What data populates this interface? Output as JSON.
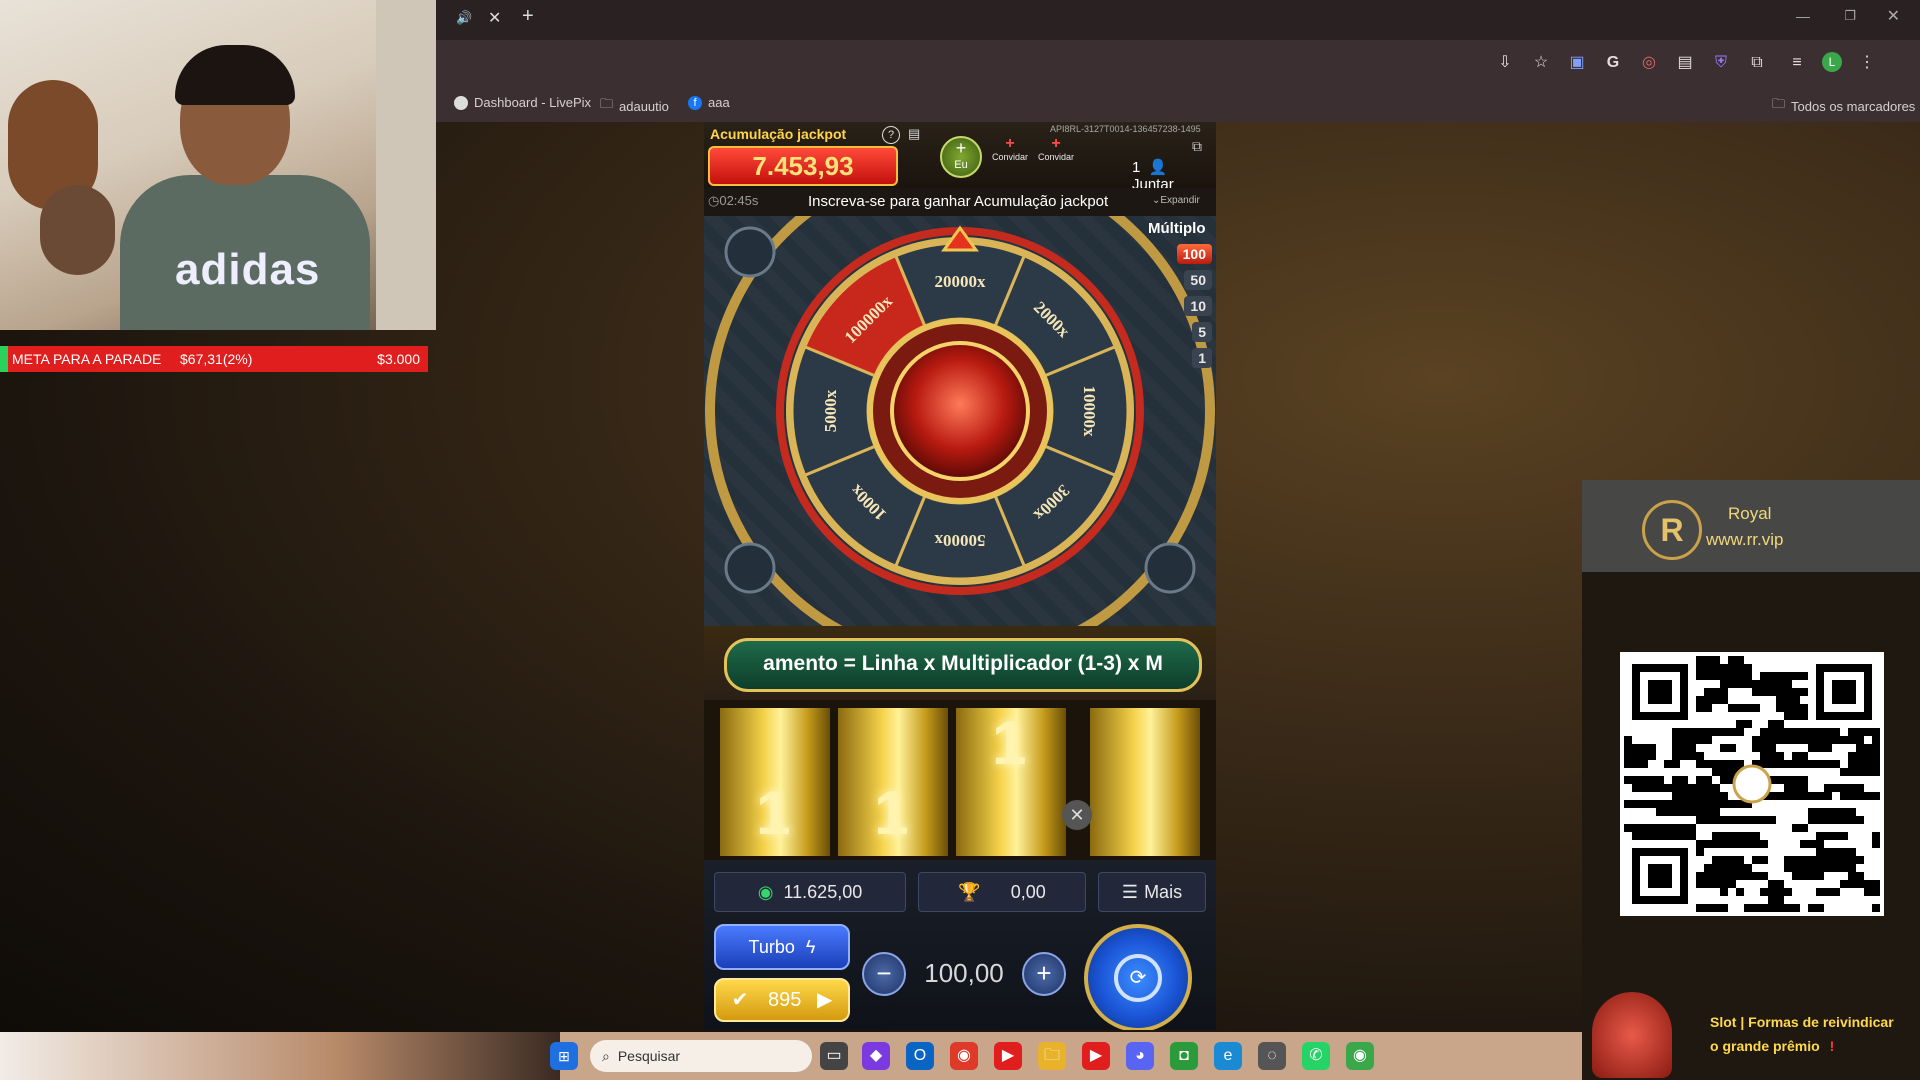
{
  "stream_overlay": {
    "goal_label": "META PARA A PARADE",
    "goal_progress": "$67,31(2%)",
    "goal_target": "$3.000",
    "goal_fraction": 0.02,
    "shirt_brand": "adidas"
  },
  "browser": {
    "tab_audio_icon": "speaker-icon",
    "bookmarks": [
      {
        "label": "Dashboard - LivePix",
        "icon": "livepix-icon"
      },
      {
        "label": "adauutio",
        "icon": "folder-icon"
      },
      {
        "label": "aaa",
        "icon": "facebook-icon"
      }
    ],
    "all_bookmarks": "Todos os marcadores",
    "profile_initial": "L"
  },
  "game": {
    "jackpot_title": "Acumulação jackpot",
    "jackpot_value": "7.453,93",
    "eu_label": "Eu",
    "convidar_1": "Convidar",
    "convidar_2": "Convidar",
    "game_id": "API8RL-3127T0014-136457238-1495",
    "players": "1",
    "juntar": "Juntar",
    "timer": "02:45s",
    "subscribe_text": "Inscreva-se para ganhar Acumulação jackpot",
    "expand": "Expandir",
    "multiplo_title": "Múltiplo",
    "multipliers": [
      "100",
      "50",
      "10",
      "5",
      "1"
    ],
    "wheel_segments": [
      "20000x",
      "2000x",
      "10000x",
      "3000x",
      "50000x",
      "1000x",
      "5000x",
      "100000x"
    ],
    "formula": "amento = Linha x Multiplicador (1-3) x M",
    "reels": [
      "1",
      "1",
      "1",
      ""
    ],
    "balance": "11.625,00",
    "win": "0,00",
    "more_label": "Mais",
    "turbo_label": "Turbo",
    "auto_count": "895",
    "bet_value": "100,00"
  },
  "side_panel": {
    "brand": "Royal",
    "url": "www.rr.vip",
    "promo_line1": "Slot | Formas de reivindicar",
    "promo_line2": "o grande prêmio",
    "promo_mark": "!"
  },
  "taskbar": {
    "search_placeholder": "Pesquisar"
  }
}
